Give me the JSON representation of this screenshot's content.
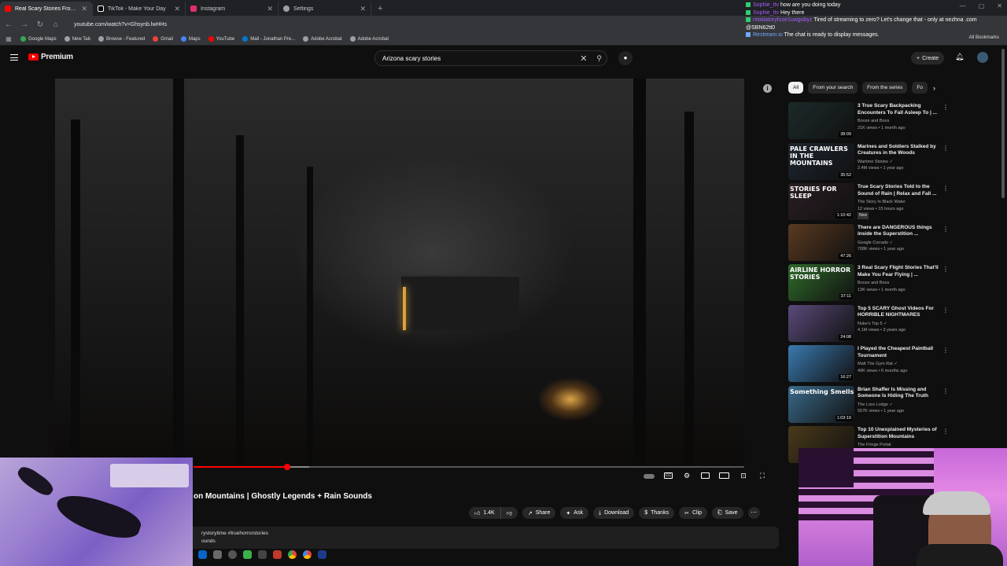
{
  "browser": {
    "tabs": [
      {
        "title": "Real Scary Stories From The Su",
        "active": true,
        "color": "#ff0000"
      },
      {
        "title": "TikTok - Make Your Day",
        "active": false,
        "color": "#ffffff"
      },
      {
        "title": "Instagram",
        "active": false,
        "color": "#e1306c"
      },
      {
        "title": "Settings",
        "active": false,
        "color": "#9aa0a6"
      }
    ],
    "url": "youtube.com/watch?v=Ghsynb.lwHHs",
    "bookmarks": [
      {
        "label": "Google Maps",
        "color": "#34a853"
      },
      {
        "label": "New Tab",
        "color": "#9aa0a6"
      },
      {
        "label": "Browse - Featured",
        "color": "#9aa0a6"
      },
      {
        "label": "Gmail",
        "color": "#ea4335"
      },
      {
        "label": "Maps",
        "color": "#4285f4"
      },
      {
        "label": "YouTube",
        "color": "#ff0000"
      },
      {
        "label": "Mail - Jonathan Pre...",
        "color": "#0078d4"
      },
      {
        "label": "Adobe Acrobat",
        "color": "#9aa0a6"
      },
      {
        "label": "Adobe Acrobat",
        "color": "#9aa0a6"
      }
    ],
    "all_bookmarks": "All Bookmarks"
  },
  "chat": {
    "messages": [
      {
        "user": "Sophie_ttv",
        "text": " how are you doing today"
      },
      {
        "user": "Sophie_ttv",
        "text": " Hey there"
      },
      {
        "user": "retaliatoryfuse1uwgobyz",
        "text": " Tired of streaming to zero? Let's change that - only at nezhna .com @SBN62tt0"
      },
      {
        "user": "Restream.io",
        "text": " The chat is ready to display messages."
      }
    ]
  },
  "youtube": {
    "logo_text": "Premium",
    "search_query": "Arizona scary stories",
    "create_label": "Create",
    "video_title": "on Mountains | Ghostly Legends + Rain Sounds",
    "progress": 0.17,
    "buffered": 0.21,
    "actions": {
      "likes": "1.4K",
      "share": "Share",
      "ask": "Ask",
      "download": "Download",
      "thanks": "Thanks",
      "clip": "Clip",
      "save": "Save"
    },
    "description_line1": "rystorytime #truehorrorstories",
    "description_line2": "ounds"
  },
  "sidebar": {
    "chips": [
      "All",
      "From your search",
      "From the series",
      "Fo"
    ],
    "recommendations": [
      {
        "title": "3 True Scary Backpacking Encounters To Fall Asleep To | ...",
        "channel": "Booze and Boos",
        "stats": "21K views • 1 month ago",
        "duration": "38:09",
        "thumb": "#1c2a2a",
        "overlay": ""
      },
      {
        "title": "Marines and Soldiers Stalked by Creatures in the Woods",
        "channel": "Wartime Stories ✓",
        "stats": "2.4M views • 1 year ago",
        "duration": "35:52",
        "thumb": "#1d2630",
        "overlay": "PALE CRAWLERS IN THE MOUNTAINS"
      },
      {
        "title": "True Scary Stories Told to the Sound of Rain | Relax and Fall ...",
        "channel": "The Story In Black Water",
        "stats": "12 views • 15 hours ago",
        "duration": "1:10:42",
        "thumb": "#2a1e24",
        "overlay": "STORIES FOR SLEEP",
        "badge": "New"
      },
      {
        "title": "There are DANGEROUS things inside the Superstition ...",
        "channel": "Google Corrado ✓",
        "stats": "708K views • 1 year ago",
        "duration": "47:26",
        "thumb": "#5a3a20",
        "overlay": ""
      },
      {
        "title": "3 Real Scary Flight Stories That'll Make You Fear Flying | ...",
        "channel": "Booze and Boos",
        "stats": "13K views • 1 month ago",
        "duration": "37:11",
        "thumb": "#2f6a2a",
        "overlay": "AIRLINE HORROR STORIES"
      },
      {
        "title": "Top 5 SCARY Ghost Videos For HORRIBLE NIGHTMARES",
        "channel": "Nuke's Top 5 ✓",
        "stats": "4.1M views • 3 years ago",
        "duration": "24:08",
        "thumb": "#5a4a7a",
        "overlay": ""
      },
      {
        "title": "I Played the Cheapest Paintball Tournament",
        "channel": "Matt The Gym Rat ✓",
        "stats": "49K views • 6 months ago",
        "duration": "16:27",
        "thumb": "#3a7ab0",
        "overlay": ""
      },
      {
        "title": "Brian Shaffer Is Missing and Someone Is Hiding The Truth",
        "channel": "The Lore Lodge ✓",
        "stats": "557K views • 1 year ago",
        "duration": "1:03:19",
        "thumb": "#3a6a8a",
        "overlay": "Something Smells"
      },
      {
        "title": "Top 10 Unexplained Mysteries of Superstition Mountains",
        "channel": "The Fringe Portal",
        "stats": "",
        "duration": "",
        "thumb": "#4a3a1a",
        "overlay": ""
      }
    ]
  }
}
